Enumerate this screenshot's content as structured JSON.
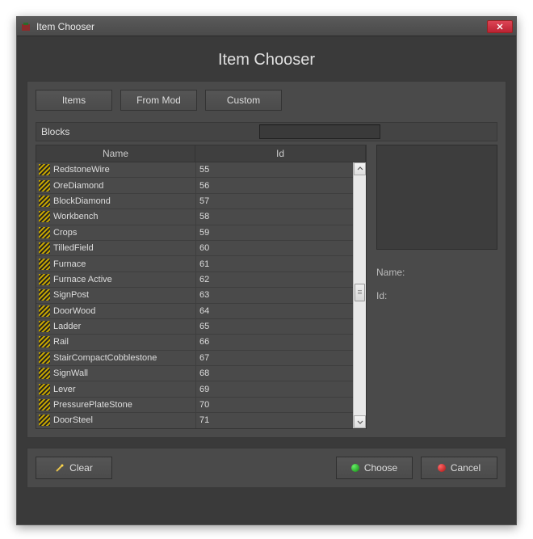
{
  "window": {
    "title": "Item Chooser"
  },
  "header": "Item Chooser",
  "tabs": {
    "items": "Items",
    "from_mod": "From Mod",
    "custom": "Custom"
  },
  "filter": {
    "label": "Blocks",
    "value": ""
  },
  "columns": {
    "name": "Name",
    "id": "Id"
  },
  "rows": [
    {
      "name": "RedstoneWire",
      "id": "55"
    },
    {
      "name": "OreDiamond",
      "id": "56"
    },
    {
      "name": "BlockDiamond",
      "id": "57"
    },
    {
      "name": "Workbench",
      "id": "58"
    },
    {
      "name": "Crops",
      "id": "59"
    },
    {
      "name": "TilledField",
      "id": "60"
    },
    {
      "name": "Furnace",
      "id": "61"
    },
    {
      "name": "Furnace Active",
      "id": "62"
    },
    {
      "name": "SignPost",
      "id": "63"
    },
    {
      "name": "DoorWood",
      "id": "64"
    },
    {
      "name": "Ladder",
      "id": "65"
    },
    {
      "name": "Rail",
      "id": "66"
    },
    {
      "name": "StairCompactCobblestone",
      "id": "67"
    },
    {
      "name": "SignWall",
      "id": "68"
    },
    {
      "name": "Lever",
      "id": "69"
    },
    {
      "name": "PressurePlateStone",
      "id": "70"
    },
    {
      "name": "DoorSteel",
      "id": "71"
    }
  ],
  "details": {
    "name_label": "Name:",
    "id_label": "Id:"
  },
  "buttons": {
    "clear": "Clear",
    "choose": "Choose",
    "cancel": "Cancel"
  }
}
